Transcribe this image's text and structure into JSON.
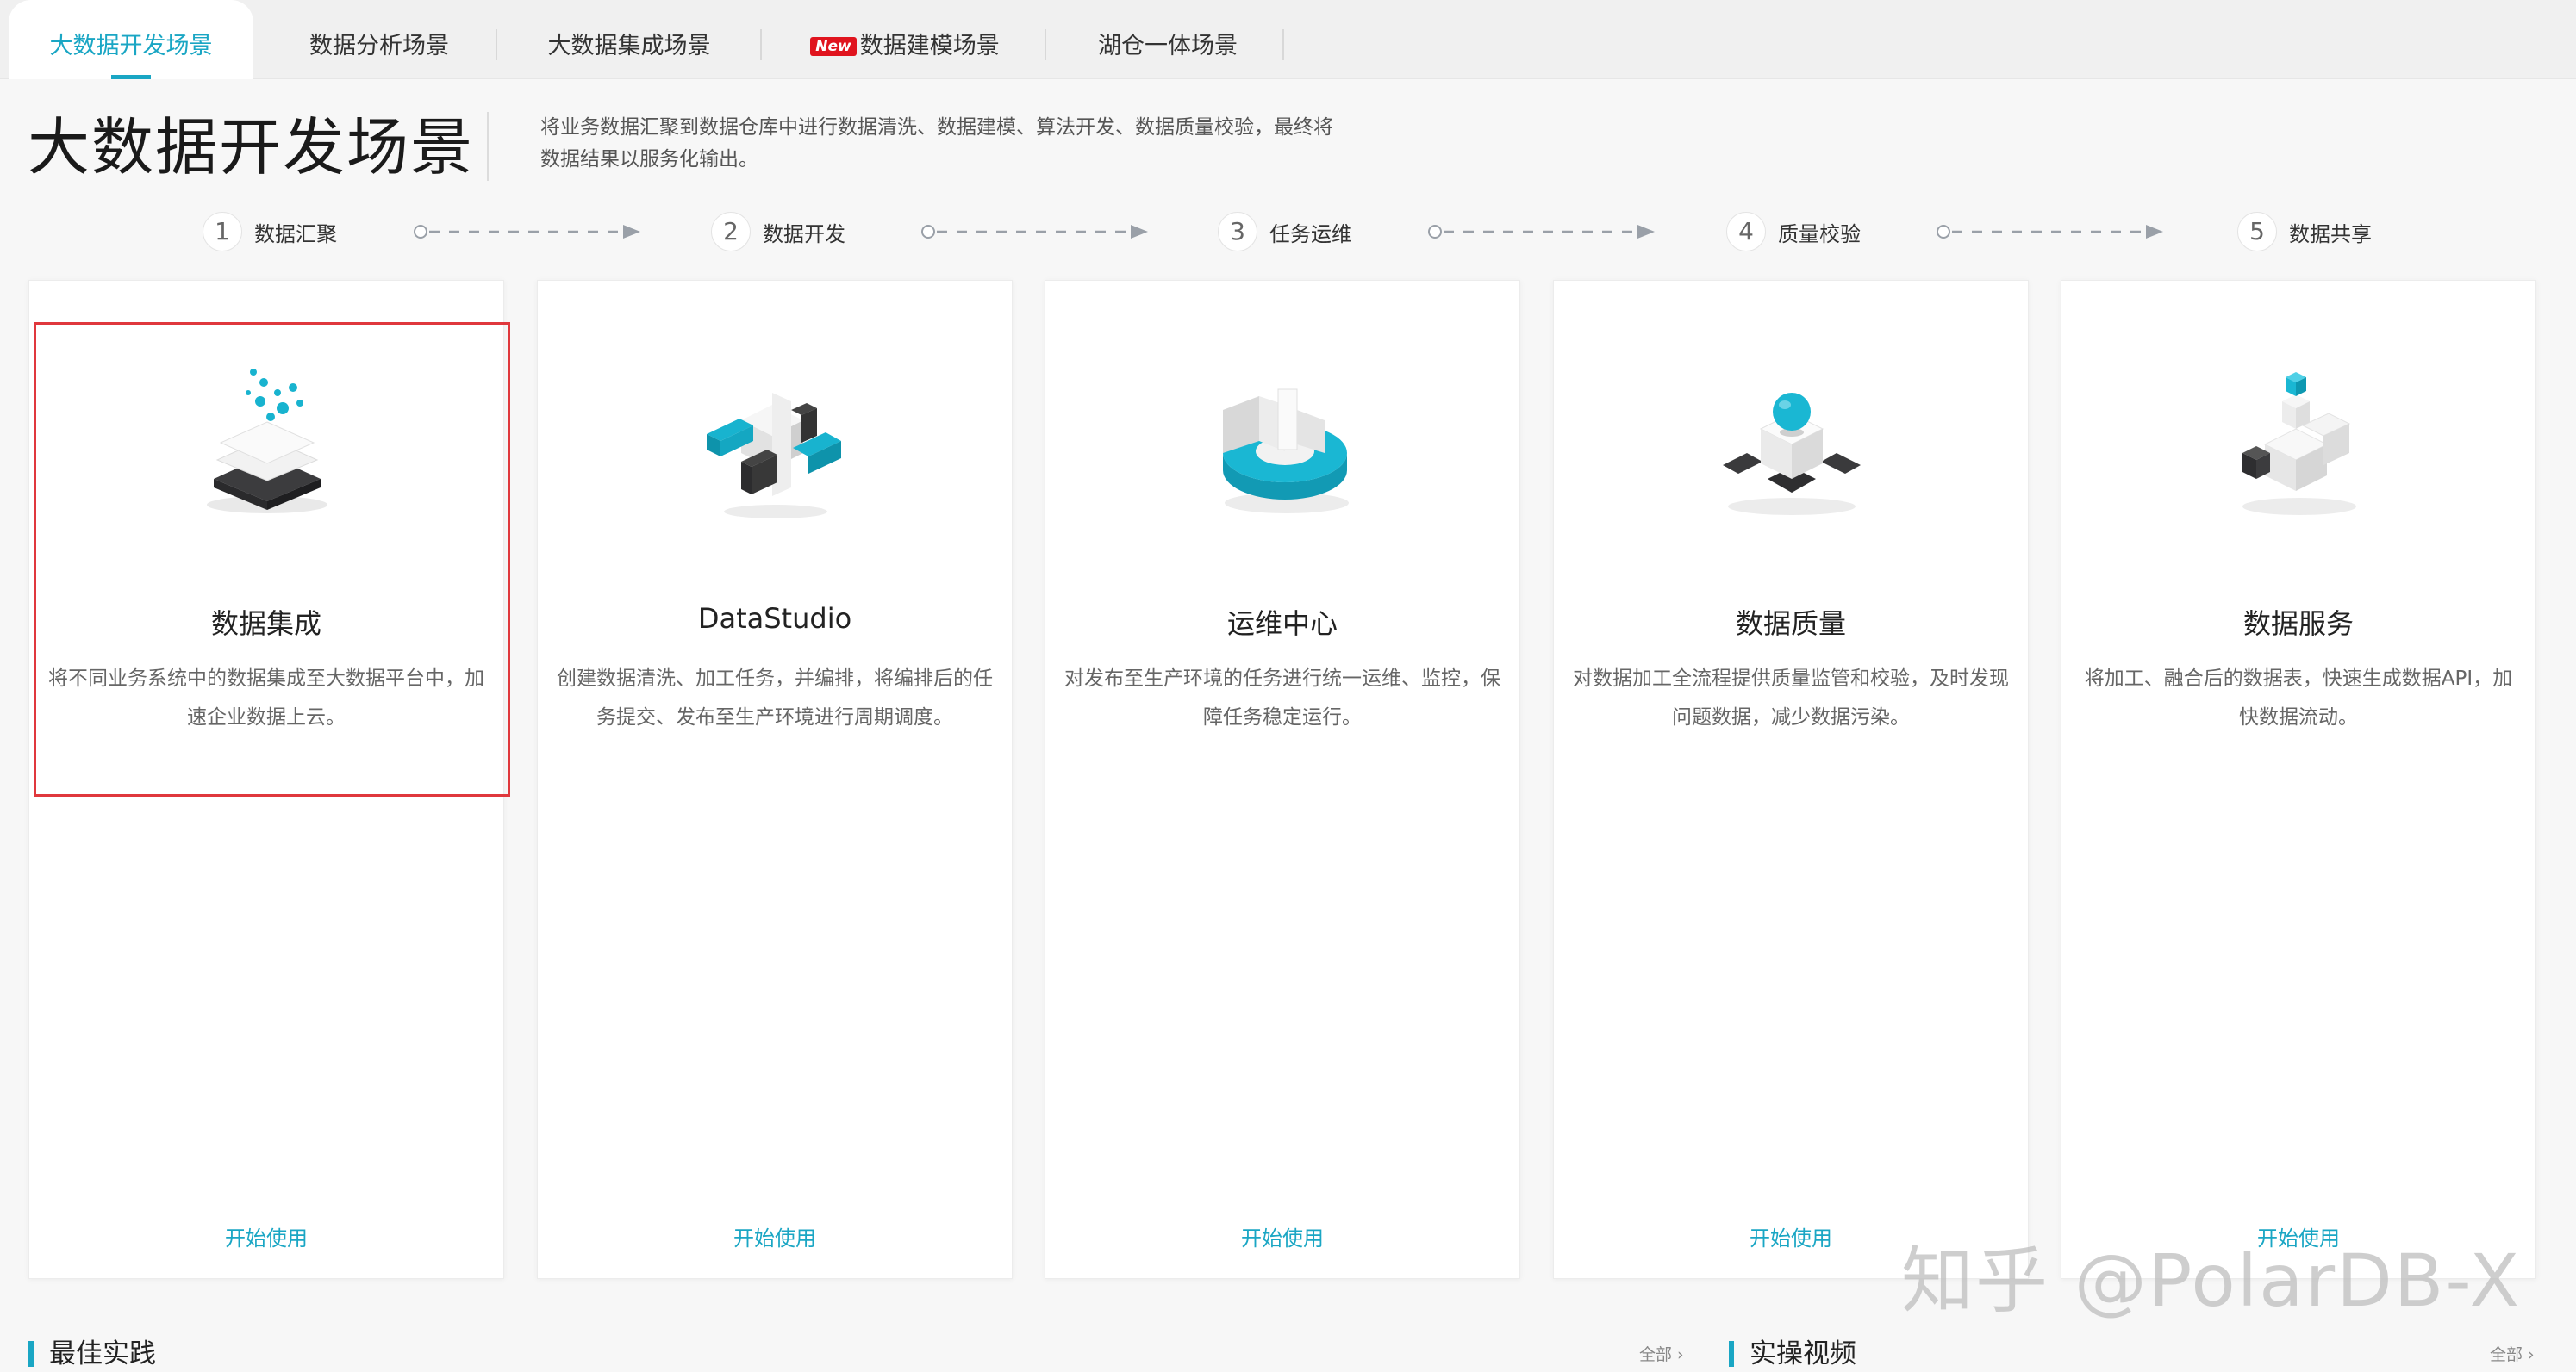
{
  "tabs": [
    {
      "label": "大数据开发场景",
      "active": true
    },
    {
      "label": "数据分析场景"
    },
    {
      "label": "大数据集成场景"
    },
    {
      "label": "数据建模场景",
      "badge": "New"
    },
    {
      "label": "湖仓一体场景"
    }
  ],
  "header": {
    "title": "大数据开发场景",
    "description": "将业务数据汇聚到数据仓库中进行数据清洗、数据建模、算法开发、数据质量校验，最终将数据结果以服务化输出。"
  },
  "steps": [
    {
      "num": "1",
      "label": "数据汇聚"
    },
    {
      "num": "2",
      "label": "数据开发"
    },
    {
      "num": "3",
      "label": "任务运维"
    },
    {
      "num": "4",
      "label": "质量校验"
    },
    {
      "num": "5",
      "label": "数据共享"
    }
  ],
  "cards": [
    {
      "title": "数据集成",
      "desc": "将不同业务系统中的数据集成至大数据平台中，加速企业数据上云。",
      "link": "开始使用",
      "icon": "layered-stack-icon"
    },
    {
      "title": "DataStudio",
      "desc": "创建数据清洗、加工任务，并编排，将编排后的任务提交、发布至生产环境进行周期调度。",
      "link": "开始使用",
      "icon": "cross-blocks-icon"
    },
    {
      "title": "运维中心",
      "desc": "对发布至生产环境的任务进行统一运维、监控，保障任务稳定运行。",
      "link": "开始使用",
      "icon": "ring-chart-icon"
    },
    {
      "title": "数据质量",
      "desc": "对数据加工全流程提供质量监管和校验，及时发现问题数据，减少数据污染。",
      "link": "开始使用",
      "icon": "cube-sphere-icon"
    },
    {
      "title": "数据服务",
      "desc": "将加工、融合后的数据表，快速生成数据API，加快数据流动。",
      "link": "开始使用",
      "icon": "cube-cluster-icon"
    }
  ],
  "sections": {
    "best_practice": "最佳实践",
    "videos": "实操视频",
    "more": "全部 ›"
  },
  "watermark": "知乎 @PolarDB-X",
  "colors": {
    "accent": "#1aa6c4",
    "highlight": "#e0383d",
    "badge": "#e0141e"
  }
}
